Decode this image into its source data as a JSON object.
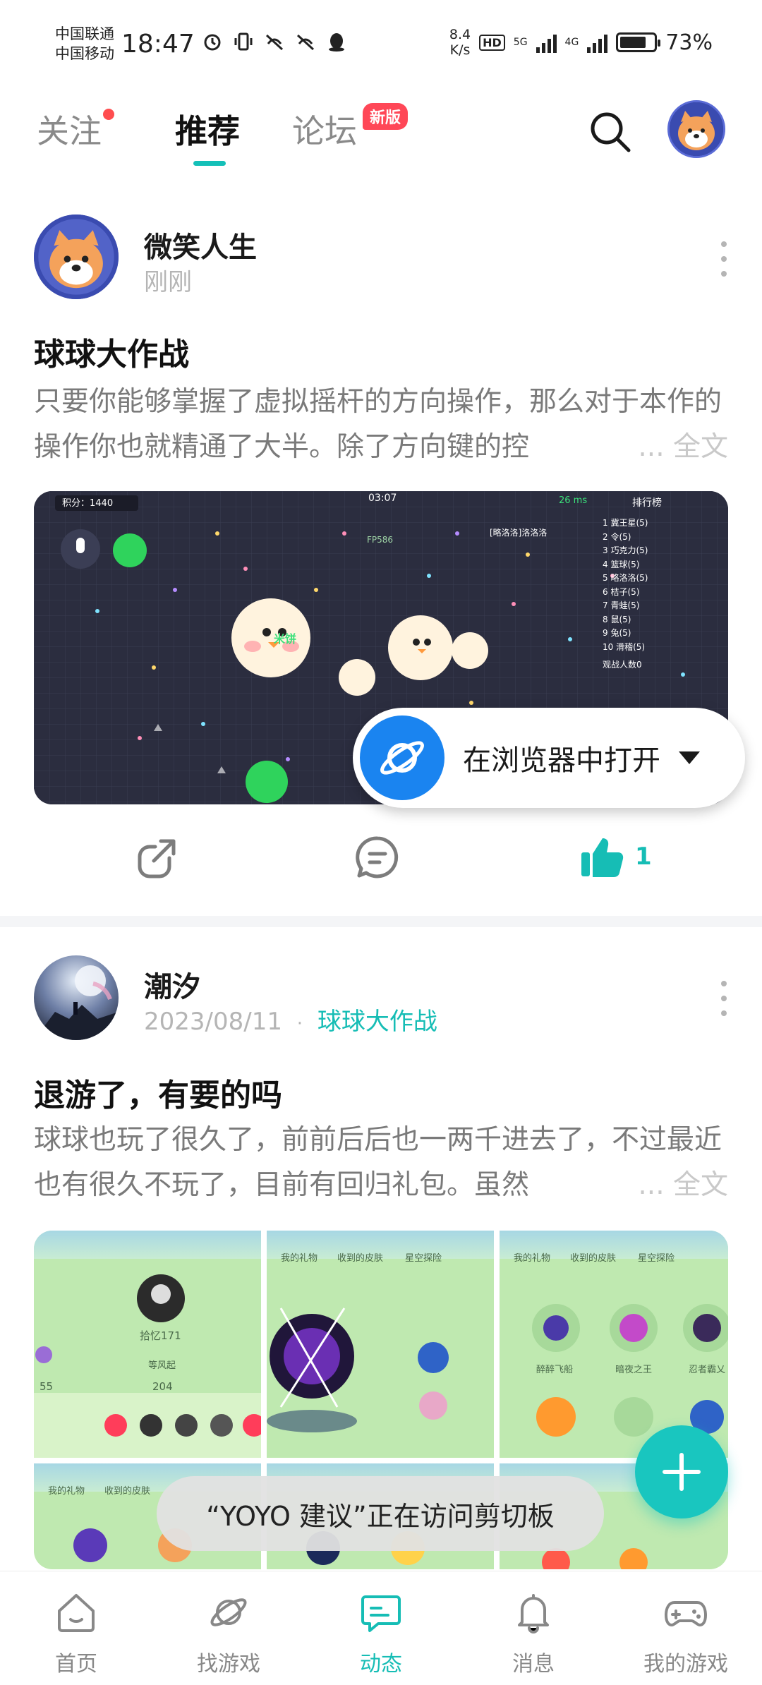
{
  "status_bar": {
    "carrier1": "中国联通",
    "carrier2": "中国移动",
    "time": "18:47",
    "speed_value": "8.4",
    "speed_unit": "K/s",
    "hd": "HD",
    "net1": "5G",
    "net2": "4G",
    "battery": "73%"
  },
  "header": {
    "tabs": [
      {
        "label": "关注"
      },
      {
        "label": "推荐"
      },
      {
        "label": "论坛"
      }
    ],
    "new_badge": "新版"
  },
  "posts": [
    {
      "author": "微笑人生",
      "time": "刚刚",
      "title": "球球大作战",
      "body": "只要你能够掌握了虚拟摇杆的方向操作，那么对于本作的操作你也就精通了大半。除了方向键的控",
      "more": "... 全文",
      "game_screen": {
        "score": "积分：1440",
        "timer": "03:07",
        "ping": "26 ms",
        "leaderboard_title": "排行榜",
        "leaderboard": [
          "1 冀王星(5)",
          "2 令(5)",
          "3 巧克力(5)",
          "4 篮球(5)",
          "5 略洛洛(5)",
          "6 桔子(5)",
          "7 青蛙(5)",
          "8 鼠(5)",
          "9 兔(5)",
          "10 滑稽(5)"
        ],
        "spectators": "观战人数0",
        "player_tag": "FP586",
        "player_name": "米饼",
        "enemy_tag": "[略洛洛]洛洛洛"
      },
      "likes": "1"
    },
    {
      "author": "潮汐",
      "date": "2023/08/11",
      "separator": "·",
      "game": "球球大作战",
      "title": "退游了，有要的吗",
      "body": "球球也玩了很久了，前前后后也一两千进去了，不过最近也有很久不玩了，目前有回归礼包。虽然",
      "more": "... 全文",
      "thumb_texts": {
        "gift": "我的礼物",
        "skins": "收到的皮肤",
        "explore": "星空探险",
        "profile_name": "拾忆171",
        "rank": "等风起",
        "stat1": "55",
        "stat2": "204",
        "skin1": "醉醉飞船",
        "skin2": "暗夜之王",
        "skin3": "忍者霸乂"
      }
    }
  ],
  "browser_pill": {
    "label": "在浏览器中打开"
  },
  "toast": "“YOYO 建议”正在访问剪切板",
  "bottom_nav": [
    {
      "label": "首页",
      "icon": "home-icon"
    },
    {
      "label": "找游戏",
      "icon": "planet-icon"
    },
    {
      "label": "动态",
      "icon": "chat-icon"
    },
    {
      "label": "消息",
      "icon": "bell-icon"
    },
    {
      "label": "我的游戏",
      "icon": "gamepad-icon"
    }
  ],
  "colors": {
    "accent": "#16bdb5",
    "badge": "#ff4757",
    "browser_blue": "#1a84f0"
  }
}
